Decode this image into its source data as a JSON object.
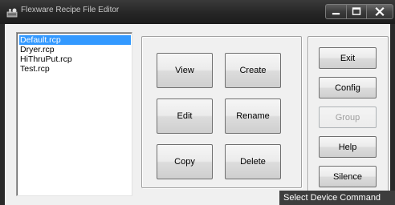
{
  "window": {
    "title": "Flexware Recipe File Editor",
    "icon": "app-icon"
  },
  "file_list": {
    "items": [
      "Default.rcp",
      "Dryer.rcp",
      "HiThruPut.rcp",
      "Test.rcp"
    ],
    "selected_index": 0
  },
  "actions": {
    "view": "View",
    "create": "Create",
    "edit": "Edit",
    "rename": "Rename",
    "copy": "Copy",
    "delete": "Delete"
  },
  "side": {
    "exit": "Exit",
    "config": "Config",
    "group": "Group",
    "help": "Help",
    "silence": "Silence"
  },
  "tooltip": "Select Device Command",
  "colors": {
    "selection": "#3399ff",
    "titlebar": "#262626",
    "tooltip_bg": "#3d3d3d"
  }
}
